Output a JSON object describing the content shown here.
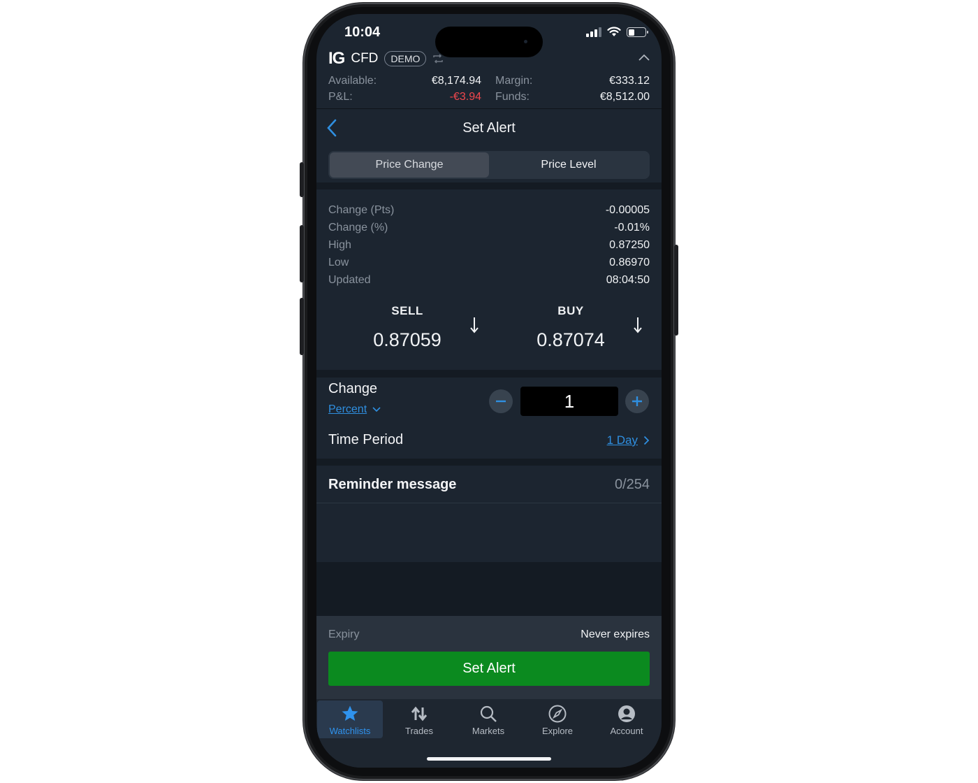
{
  "status_bar": {
    "time": "10:04"
  },
  "account": {
    "logo": "IG",
    "product": "CFD",
    "mode_badge": "DEMO",
    "available_label": "Available:",
    "available_value": "€8,174.94",
    "pnl_label": "P&L:",
    "pnl_value": "-€3.94",
    "margin_label": "Margin:",
    "margin_value": "€333.12",
    "funds_label": "Funds:",
    "funds_value": "€8,512.00"
  },
  "nav": {
    "title": "Set Alert"
  },
  "segments": {
    "price_change": "Price Change",
    "price_level": "Price Level",
    "active": "price_change"
  },
  "stats": [
    {
      "label": "Change (Pts)",
      "value": "-0.00005",
      "negative": true
    },
    {
      "label": "Change (%)",
      "value": "-0.01%",
      "negative": true
    },
    {
      "label": "High",
      "value": "0.87250",
      "negative": false
    },
    {
      "label": "Low",
      "value": "0.86970",
      "negative": false
    },
    {
      "label": "Updated",
      "value": "08:04:50",
      "negative": false
    }
  ],
  "quotes": {
    "sell_label": "SELL",
    "sell_price": "0.87059",
    "buy_label": "BUY",
    "buy_price": "0.87074"
  },
  "change": {
    "title": "Change",
    "unit": "Percent",
    "value": "1"
  },
  "time_period": {
    "label": "Time Period",
    "value": "1 Day"
  },
  "reminder": {
    "label": "Reminder message",
    "count": "0/254"
  },
  "footer": {
    "expiry_label": "Expiry",
    "expiry_value": "Never expires",
    "submit_label": "Set Alert"
  },
  "tabs": [
    {
      "label": "Watchlists",
      "icon": "star-icon",
      "active": true
    },
    {
      "label": "Trades",
      "icon": "trades-arrows-icon",
      "active": false
    },
    {
      "label": "Markets",
      "icon": "search-icon",
      "active": false
    },
    {
      "label": "Explore",
      "icon": "compass-icon",
      "active": false
    },
    {
      "label": "Account",
      "icon": "user-icon",
      "active": false
    }
  ],
  "colors": {
    "negative": "#f0474d",
    "link": "#2f8fe0",
    "submit": "#0b8a1f",
    "accent": "#2f93ee"
  }
}
